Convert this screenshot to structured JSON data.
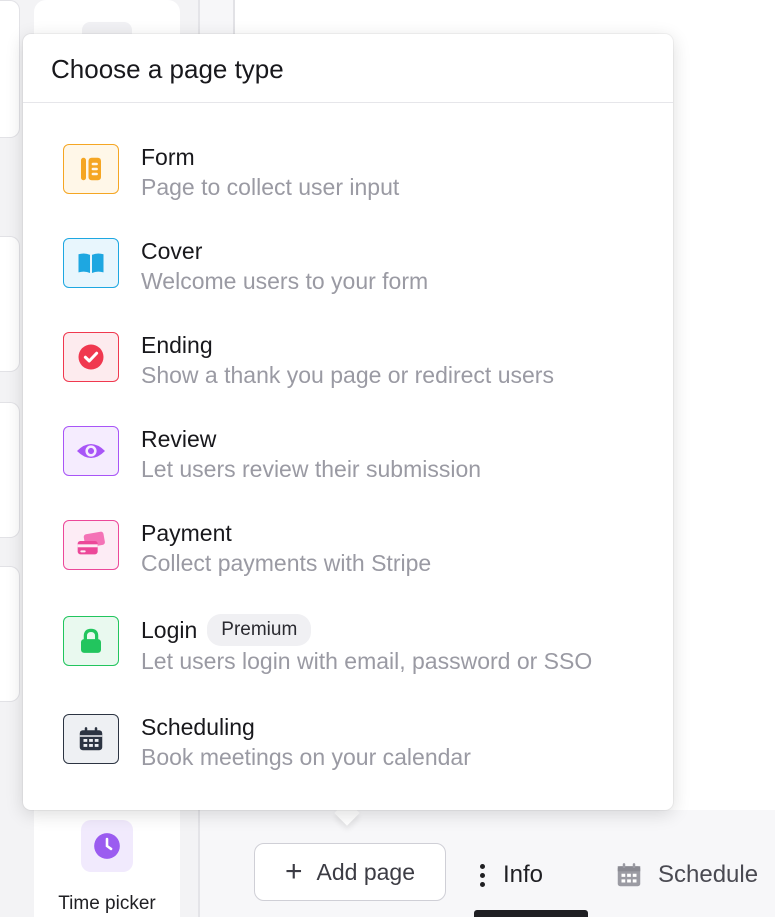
{
  "popover": {
    "title": "Choose a page type",
    "options": [
      {
        "title": "Form",
        "description": "Page to collect user input",
        "icon": "form-icon",
        "color": "#f5a623",
        "bg": "#fff7e8"
      },
      {
        "title": "Cover",
        "description": "Welcome users to your form",
        "icon": "book-icon",
        "color": "#1ea7e1",
        "bg": "#e8f6fd"
      },
      {
        "title": "Ending",
        "description": "Show a thank you page or redirect users",
        "icon": "check-circle-icon",
        "color": "#f0384f",
        "bg": "#fdebee"
      },
      {
        "title": "Review",
        "description": "Let users review their submission",
        "icon": "eye-icon",
        "color": "#a855f7",
        "bg": "#f5ecfe"
      },
      {
        "title": "Payment",
        "description": "Collect payments with Stripe",
        "icon": "credit-card-icon",
        "color": "#ec4899",
        "bg": "#fdecf5"
      },
      {
        "title": "Login",
        "badge": "Premium",
        "description": "Let users login with email, password or SSO",
        "icon": "lock-icon",
        "color": "#22c55e",
        "bg": "#e9f9ef"
      },
      {
        "title": "Scheduling",
        "description": "Book meetings on your calendar",
        "icon": "calendar-icon",
        "color": "#2c3442",
        "bg": "#eef0f3"
      }
    ]
  },
  "toolbar": {
    "add_page_label": "Add page",
    "info_label": "Info",
    "schedule_label": "Schedule"
  },
  "blocks": {
    "time_picker_label": "Time picker"
  }
}
